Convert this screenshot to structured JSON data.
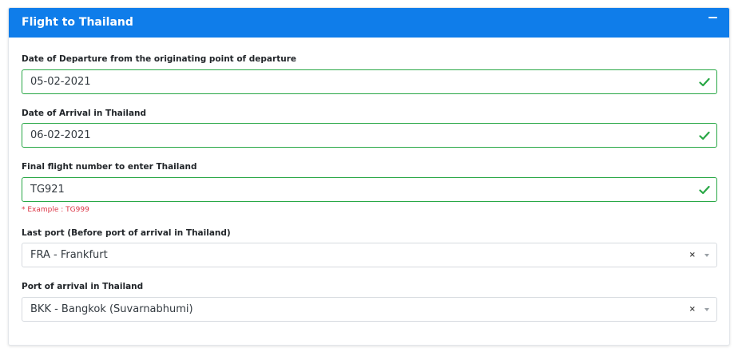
{
  "card": {
    "title": "Flight to Thailand",
    "header_color": "#0f7dea"
  },
  "fields": {
    "departure_date": {
      "label": "Date of Departure from the originating point of departure",
      "value": "05-02-2021",
      "status": "valid"
    },
    "arrival_date": {
      "label": "Date of Arrival in Thailand",
      "value": "06-02-2021",
      "status": "valid"
    },
    "flight_number": {
      "label": "Final flight number to enter Thailand",
      "value": "TG921",
      "hint": "* Example : TG999",
      "status": "valid"
    },
    "last_port": {
      "label": "Last port (Before port of arrival in Thailand)",
      "selected": "FRA - Frankfurt",
      "clear_symbol": "×"
    },
    "arrival_port": {
      "label": "Port of arrival in Thailand",
      "selected": "BKK - Bangkok (Suvarnabhumi)",
      "clear_symbol": "×"
    }
  },
  "colors": {
    "valid": "#28a745",
    "hint": "#dc3545"
  },
  "icons": {
    "collapse": "minus-icon",
    "valid": "check-icon",
    "clear": "clear-icon",
    "dropdown": "chevron-down-icon"
  }
}
